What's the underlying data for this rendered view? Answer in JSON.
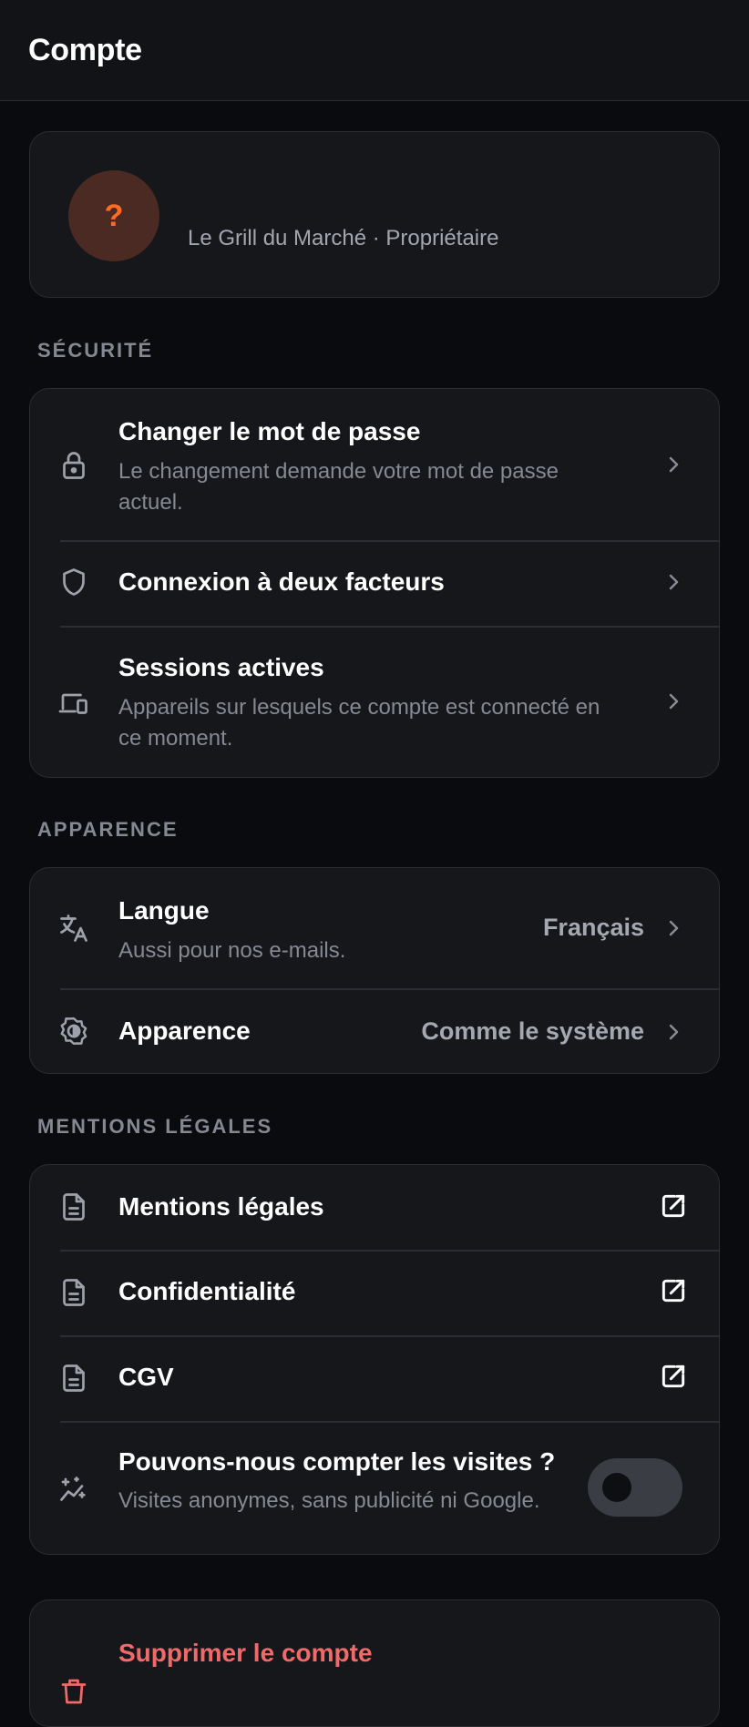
{
  "header": {
    "title": "Compte"
  },
  "profile": {
    "avatar_glyph": "?",
    "subtitle": "Le Grill du Marché · Propriétaire"
  },
  "security": {
    "label": "SÉCURITÉ",
    "items": [
      {
        "icon": "lock-icon",
        "title": "Changer le mot de passe",
        "subtitle": "Le changement demande votre mot de passe actuel."
      },
      {
        "icon": "shield-icon",
        "title": "Connexion à deux facteurs"
      },
      {
        "icon": "devices-icon",
        "title": "Sessions actives",
        "subtitle": "Appareils sur lesquels ce compte est connecté en ce moment."
      }
    ]
  },
  "appearance": {
    "label": "APPARENCE",
    "items": [
      {
        "icon": "translate-icon",
        "title": "Langue",
        "subtitle": "Aussi pour nos e-mails.",
        "value": "Français"
      },
      {
        "icon": "brightness-icon",
        "title": "Apparence",
        "value": "Comme le système"
      }
    ]
  },
  "legal": {
    "label": "MENTIONS LÉGALES",
    "items": [
      {
        "icon": "document-icon",
        "title": "Mentions légales"
      },
      {
        "icon": "document-icon",
        "title": "Confidentialité"
      },
      {
        "icon": "document-icon",
        "title": "CGV"
      }
    ],
    "analytics": {
      "icon": "sparkle-chart-icon",
      "title": "Pouvons-nous compter les visites ?",
      "subtitle": "Visites anonymes, sans publicité ni Google.",
      "enabled": false
    }
  },
  "danger": {
    "title": "Supprimer le compte"
  },
  "colors": {
    "background": "#0a0b0e",
    "card": "#16171b",
    "accent": "#ff6a26",
    "danger": "#f06a6a"
  }
}
